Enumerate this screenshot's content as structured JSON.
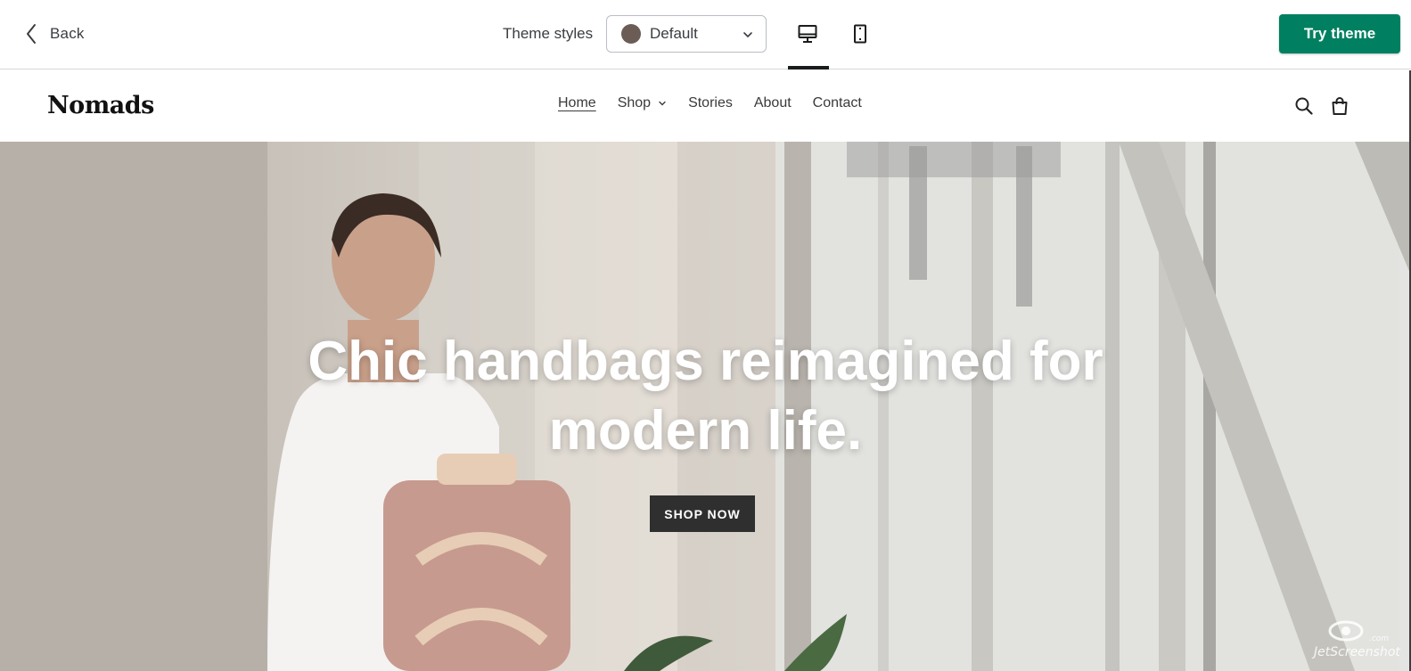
{
  "toolbar": {
    "back_label": "Back",
    "theme_styles_label": "Theme styles",
    "style_select": {
      "value": "Default",
      "swatch_color": "#6b5d56"
    },
    "devices": [
      "desktop",
      "mobile"
    ],
    "active_device": "desktop",
    "try_theme_label": "Try theme",
    "accent_color": "#008060"
  },
  "store": {
    "logo": "Nomads",
    "nav": [
      {
        "label": "Home",
        "active": true
      },
      {
        "label": "Shop",
        "has_dropdown": true
      },
      {
        "label": "Stories"
      },
      {
        "label": "About"
      },
      {
        "label": "Contact"
      }
    ],
    "icons": [
      "search-icon",
      "cart-icon"
    ]
  },
  "hero": {
    "title_line1": "Chic handbags reimagined for",
    "title_line2": "modern life.",
    "cta_label": "SHOP NOW"
  },
  "watermark": {
    "text": "JetScreenshot",
    "suffix": ".com"
  }
}
